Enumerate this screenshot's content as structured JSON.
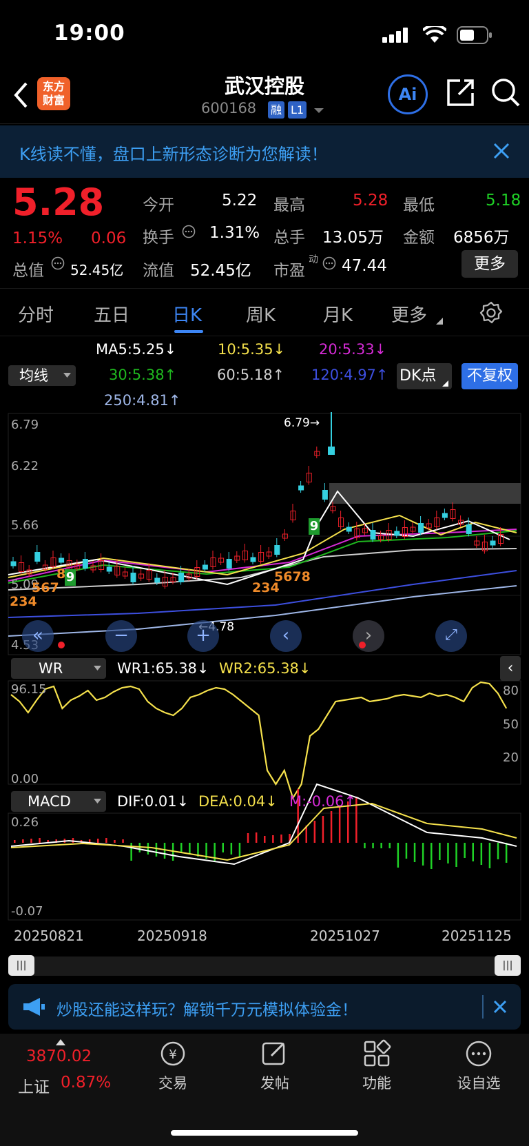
{
  "status": {
    "time": "19:00"
  },
  "header": {
    "title": "武汉控股",
    "code": "600168",
    "tag1": "融",
    "tag2": "L1",
    "logo_line1": "东方",
    "logo_line2": "财富",
    "ai_label": "Ai"
  },
  "banner": {
    "text": "K线读不懂，盘口上新形态诊断为您解读！"
  },
  "quote": {
    "price": "5.28",
    "change_pct": "1.15%",
    "change": "0.06",
    "open_label": "今开",
    "open": "5.22",
    "high_label": "最高",
    "high": "5.28",
    "low_label": "最低",
    "low": "5.18",
    "turnover_label": "换手",
    "turnover": "1.31%",
    "volume_label": "总手",
    "volume": "13.05万",
    "amount_label": "金额",
    "amount": "6856万",
    "mktcap_label": "总值",
    "mktcap": "52.45亿",
    "float_label": "流值",
    "float": "52.45亿",
    "pe_label": "市盈",
    "pe_sup": "动",
    "pe": "47.44",
    "more": "更多"
  },
  "tabs": [
    "分时",
    "五日",
    "日K",
    "周K",
    "月K",
    "更多"
  ],
  "ma": {
    "selector": "均线",
    "ma5": "MA5:5.25↓",
    "ma10": "10:5.35↓",
    "ma20": "20:5.33↓",
    "ma30": "30:5.38↑",
    "ma60": "60:5.18↑",
    "ma120": "120:4.97↑",
    "ma250": "250:4.81↑",
    "dk": "DK点",
    "fq": "不复权"
  },
  "kline": {
    "y_labels": [
      "6.79",
      "6.22",
      "5.66",
      "5.09",
      "4.53"
    ],
    "high_mark": "6.79→",
    "low_mark": "←4.78",
    "signal9a": "9",
    "signal9b": "9",
    "counts_left": "234",
    "counts_left2": "567",
    "counts_left3": "8",
    "counts_mid": "234",
    "counts_mid2": "5678"
  },
  "wr": {
    "selector": "WR",
    "wr1": "WR1:65.38↓",
    "wr2": "WR2:65.38↓",
    "top": "96.15",
    "bottom": "0.00",
    "r80": "80",
    "r50": "50",
    "r20": "20"
  },
  "macd": {
    "selector": "MACD",
    "dif": "DIF:0.01↓",
    "dea": "DEA:0.04↓",
    "m": "M:-0.06↑",
    "top": "0.26",
    "bottom": "-0.07"
  },
  "dates": [
    "20250821",
    "20250918",
    "20251027",
    "20251125"
  ],
  "ad": {
    "text": "炒股还能这样玩？解锁千万元模拟体验金！"
  },
  "bottom": {
    "index_value": "3870.02",
    "index_name": "上证",
    "index_pct": "0.87%",
    "nav1": "交易",
    "nav2": "发帖",
    "nav3": "功能",
    "nav4": "设自选"
  },
  "colors": {
    "up": "#f0202a",
    "down": "#1fd126",
    "accent": "#3d86f5",
    "ma5": "#ffffff",
    "ma10": "#f5e14c",
    "ma20": "#d62bd6",
    "ma30": "#1fb81f",
    "ma60": "#cfcfcf",
    "ma120": "#3d4fe0",
    "ma250": "#9fb7e8"
  }
}
